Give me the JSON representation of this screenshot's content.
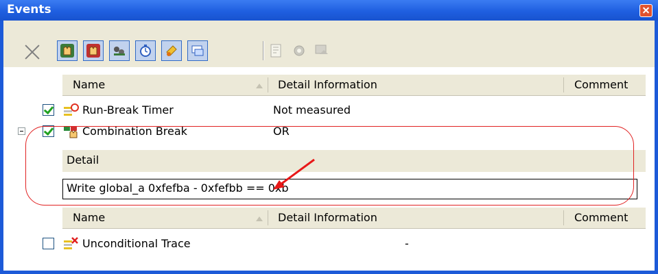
{
  "window": {
    "title": "Events"
  },
  "toolbar": {
    "buttons": [
      "delete-icon",
      "hardware-break-icon",
      "software-break-icon",
      "trace-icon",
      "timer-icon",
      "point-trace-icon",
      "watch-icon",
      "edit-icon",
      "settings-icon",
      "filter-icon"
    ]
  },
  "columns": {
    "name": "Name",
    "detail": "Detail Information",
    "comment": "Comment"
  },
  "events": [
    {
      "name": "Run-Break Timer",
      "detail": "Not measured",
      "checked": true
    },
    {
      "name": "Combination Break",
      "detail": "OR",
      "checked": true,
      "expanded": true
    }
  ],
  "detail_section": {
    "header": "Detail",
    "value": "Write  global_a 0xfefba - 0xfefbb == 0xb"
  },
  "columns2": {
    "name": "Name",
    "detail": "Detail Information",
    "comment": "Comment"
  },
  "events2": [
    {
      "name": "Unconditional Trace",
      "detail": "-",
      "checked": false
    }
  ],
  "colors": {
    "titlebar": "#1f5fe0",
    "highlight": "#e02020",
    "check": "#21a121"
  }
}
